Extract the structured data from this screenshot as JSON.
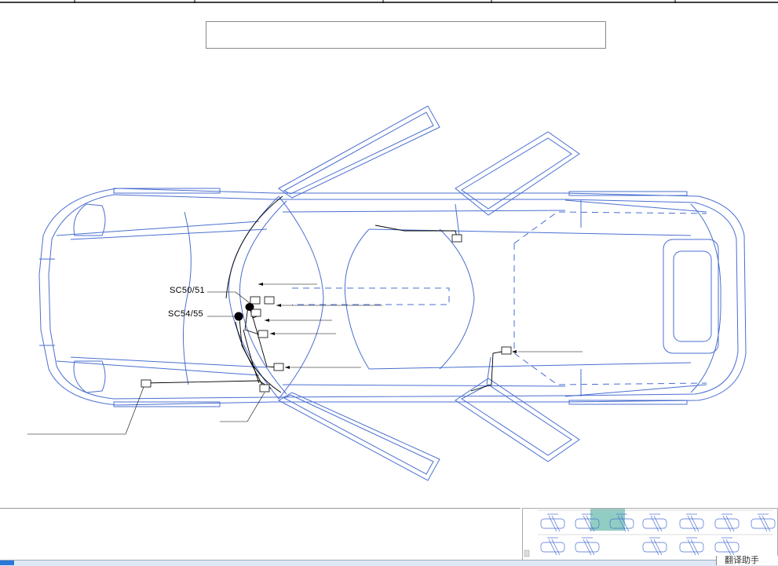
{
  "diagram": {
    "labels": {
      "sc50": "SC50/51",
      "sc54": "SC54/55"
    },
    "colors": {
      "outline": "#4a6fd0",
      "wire": "#000000"
    }
  },
  "thumbnails": {
    "count": 12,
    "selected_index": 2
  },
  "taskbar": {
    "helper_text": "翻译助手"
  }
}
